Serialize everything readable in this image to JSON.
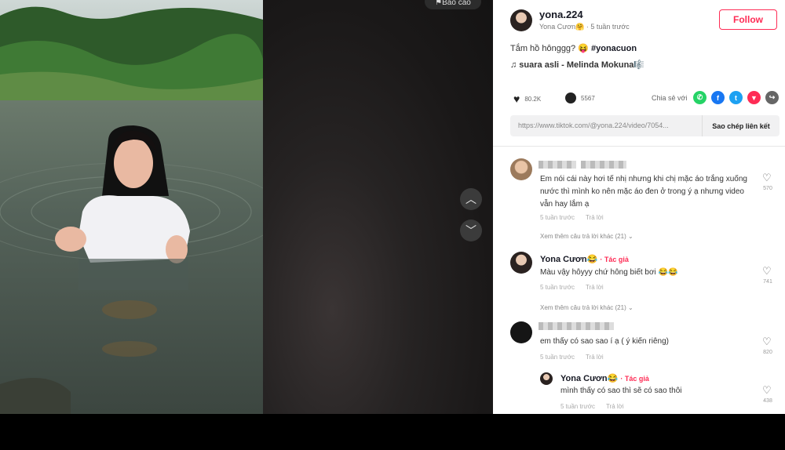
{
  "video": {
    "report_label": "Báo cáo"
  },
  "nav": {
    "up_icon": "chevron-up-icon",
    "down_icon": "chevron-down-icon"
  },
  "author": {
    "username": "yona.224",
    "subline": "Yona Cươn🤗 · 5 tuần trước",
    "follow_label": "Follow",
    "caption": "Tắm hồ hônggg? 😝",
    "hashtag": "#yonacuon",
    "music": "♫ suara asli - Melinda Mokuna🎼"
  },
  "stats": {
    "likes": "80.2K",
    "comments": "5567"
  },
  "share": {
    "label": "Chia sẻ với",
    "icons": [
      {
        "name": "whatsapp-icon",
        "color": "#25d366",
        "glyph": "✆"
      },
      {
        "name": "facebook-icon",
        "color": "#1877f2",
        "glyph": "f"
      },
      {
        "name": "twitter-icon",
        "color": "#1da1f2",
        "glyph": "t"
      },
      {
        "name": "pinterest-icon",
        "color": "#fe2c55",
        "glyph": "▼"
      },
      {
        "name": "more-share-icon",
        "color": "#666666",
        "glyph": "↪"
      }
    ]
  },
  "link": {
    "url": "https://www.tiktok.com/@yona.224/video/7054...",
    "copy_label": "Sao chép liên kết"
  },
  "comments": [
    {
      "text": "Em nói cái này hơi tế nhị nhưng khi chị mặc áo trắng xuống nước thì mình ko nên mặc áo đen ở trong ý ạ nhưng video vẫn hay lắm ạ",
      "meta_time": "5 tuần trước",
      "reply_label": "Trả lời",
      "more_replies": "Xem thêm câu trả lời khác (21) ⌄",
      "likes": "570"
    },
    {
      "name": "Yona Cươn😂",
      "author_tag": "· Tác giả",
      "text": "Màu vậy hôyyy chứ hông biết bơi 😂😂",
      "meta_time": "5 tuần trước",
      "reply_label": "Trả lời",
      "more_replies": "Xem thêm câu trả lời khác (21) ⌄",
      "likes": "741"
    },
    {
      "text": "em thấy có sao sao í ạ ( ý kiến riêng)",
      "meta_time": "5 tuần trước",
      "reply_label": "Trả lời",
      "likes": "820"
    },
    {
      "name": "Yona Cươn😂",
      "author_tag": "· Tác giả",
      "text": "mình thấy có sao thì sẽ có sao thôi",
      "meta_time": "5 tuần trước",
      "reply_label": "Trả lời",
      "likes": "438"
    }
  ]
}
